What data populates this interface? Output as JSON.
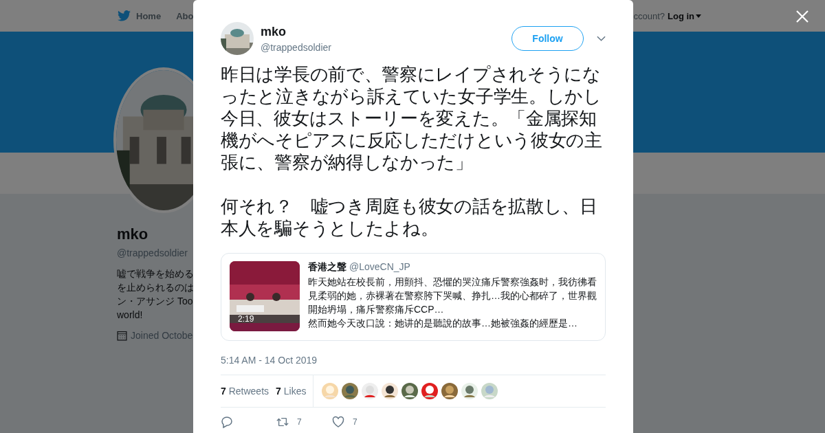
{
  "nav": {
    "items": [
      "Home",
      "Abo"
    ],
    "account_prompt": "ccount?",
    "login": "Log in"
  },
  "profile": {
    "name": "mko",
    "handle": "@trappedsoldier",
    "bio_lines": [
      "嘘で戦争を始める",
      "を止められるのは",
      "ン・アサンジ Too",
      "world!"
    ],
    "joined": "Joined Octobe"
  },
  "tweet": {
    "name": "mko",
    "handle": "@trappedsoldier",
    "follow": "Follow",
    "paragraphs": [
      "昨日は学長の前で、警察にレイプされそうになったと泣きながら訴えていた女子学生。しかし今日、彼女はストーリーを変えた。「金属探知機がへそピアスに反応しただけという彼女の主張に、警察が納得しなかった」",
      "何それ？　嘘つき周庭も彼女の話を拡散し、日本人を騙そうとしたよね。"
    ],
    "quote": {
      "name": "香港之聲",
      "handle": "@LoveCN_JP",
      "duration": "2:19",
      "text": "昨天她站在校長前，用顫抖、恐懼的哭泣痛斥警察強姦时，我彷彿看見柔弱的她，赤裸著在警察胯下哭喊、挣扎…我的心都碎了，世界觀開始坍塌，痛斥警察痛斥CCP…\n然而她今天改口說：她讲的是聽說的故事…她被強姦的經歷是…"
    },
    "time": "5:14 AM - 14 Oct 2019",
    "stats": [
      {
        "count": "7",
        "label": "Retweets"
      },
      {
        "count": "7",
        "label": "Likes"
      }
    ],
    "likers": [
      {
        "kind": "picture"
      },
      {
        "kind": "picture"
      },
      {
        "kind": "picture"
      },
      {
        "kind": "picture"
      },
      {
        "kind": "picture"
      },
      {
        "kind": "picture"
      },
      {
        "kind": "picture"
      },
      {
        "kind": "picture"
      },
      {
        "kind": "picture"
      }
    ],
    "actions": [
      {
        "kind": "reply"
      },
      {
        "kind": "retweet",
        "count": "7"
      },
      {
        "kind": "like",
        "count": "7"
      }
    ]
  }
}
